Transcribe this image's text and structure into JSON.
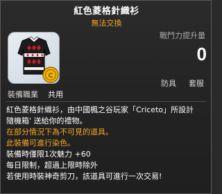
{
  "item": {
    "name": "紅色菱格針織衫",
    "trade_status": "無法交換",
    "icon": "red-diamond-knit-sweater-icon",
    "coin_badge_icon": "gold-coin-icon"
  },
  "power": {
    "label": "戰鬥力提升量",
    "value": "0"
  },
  "equip_job": {
    "label": "裝備職業",
    "value": "共用"
  },
  "tabs": {
    "armor": "防具",
    "set": "套服"
  },
  "description": {
    "line1": "紅色菱格針織衫，由中國楓之谷玩家「Criceto」所設計",
    "line2": "隨機箱' 送給你的禮物。",
    "warning1": "在部分情況下為不可見的道具。",
    "warning2": "此裝備可進行染色。",
    "stat_line": "裝備時僅限1次魅力 +60",
    "period_line": "每日限制，超過上限時除外",
    "scissors_line": "若使用時裝神奇剪刀，該道具可進行一次交易!"
  },
  "colors": {
    "accent_orange": "#f5a623",
    "text_white": "#ffffff",
    "label_gray": "#a9a9a9"
  }
}
